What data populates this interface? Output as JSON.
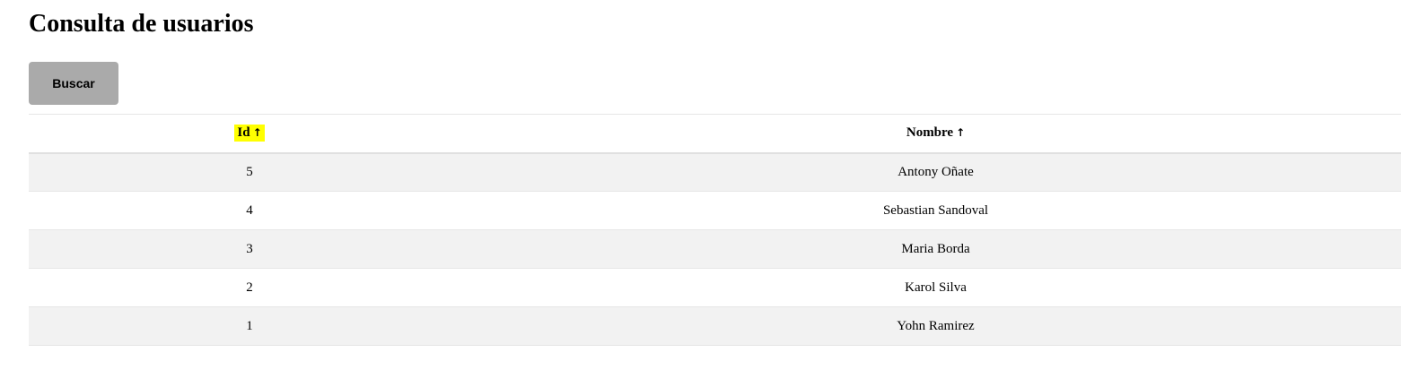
{
  "page": {
    "title": "Consulta de usuarios"
  },
  "toolbar": {
    "search_label": "Buscar"
  },
  "table": {
    "columns": [
      {
        "label": "Id",
        "sort_arrow": "↑",
        "highlighted": true
      },
      {
        "label": "Nombre",
        "sort_arrow": "↑",
        "highlighted": false
      }
    ],
    "rows": [
      {
        "id": "5",
        "nombre": "Antony Oñate"
      },
      {
        "id": "4",
        "nombre": "Sebastian Sandoval"
      },
      {
        "id": "3",
        "nombre": "Maria Borda"
      },
      {
        "id": "2",
        "nombre": "Karol Silva"
      },
      {
        "id": "1",
        "nombre": "Yohn Ramirez"
      }
    ]
  },
  "colors": {
    "button_bg": "#aaaaaa",
    "row_stripe": "#f2f2f2",
    "highlight": "#ffff00"
  }
}
